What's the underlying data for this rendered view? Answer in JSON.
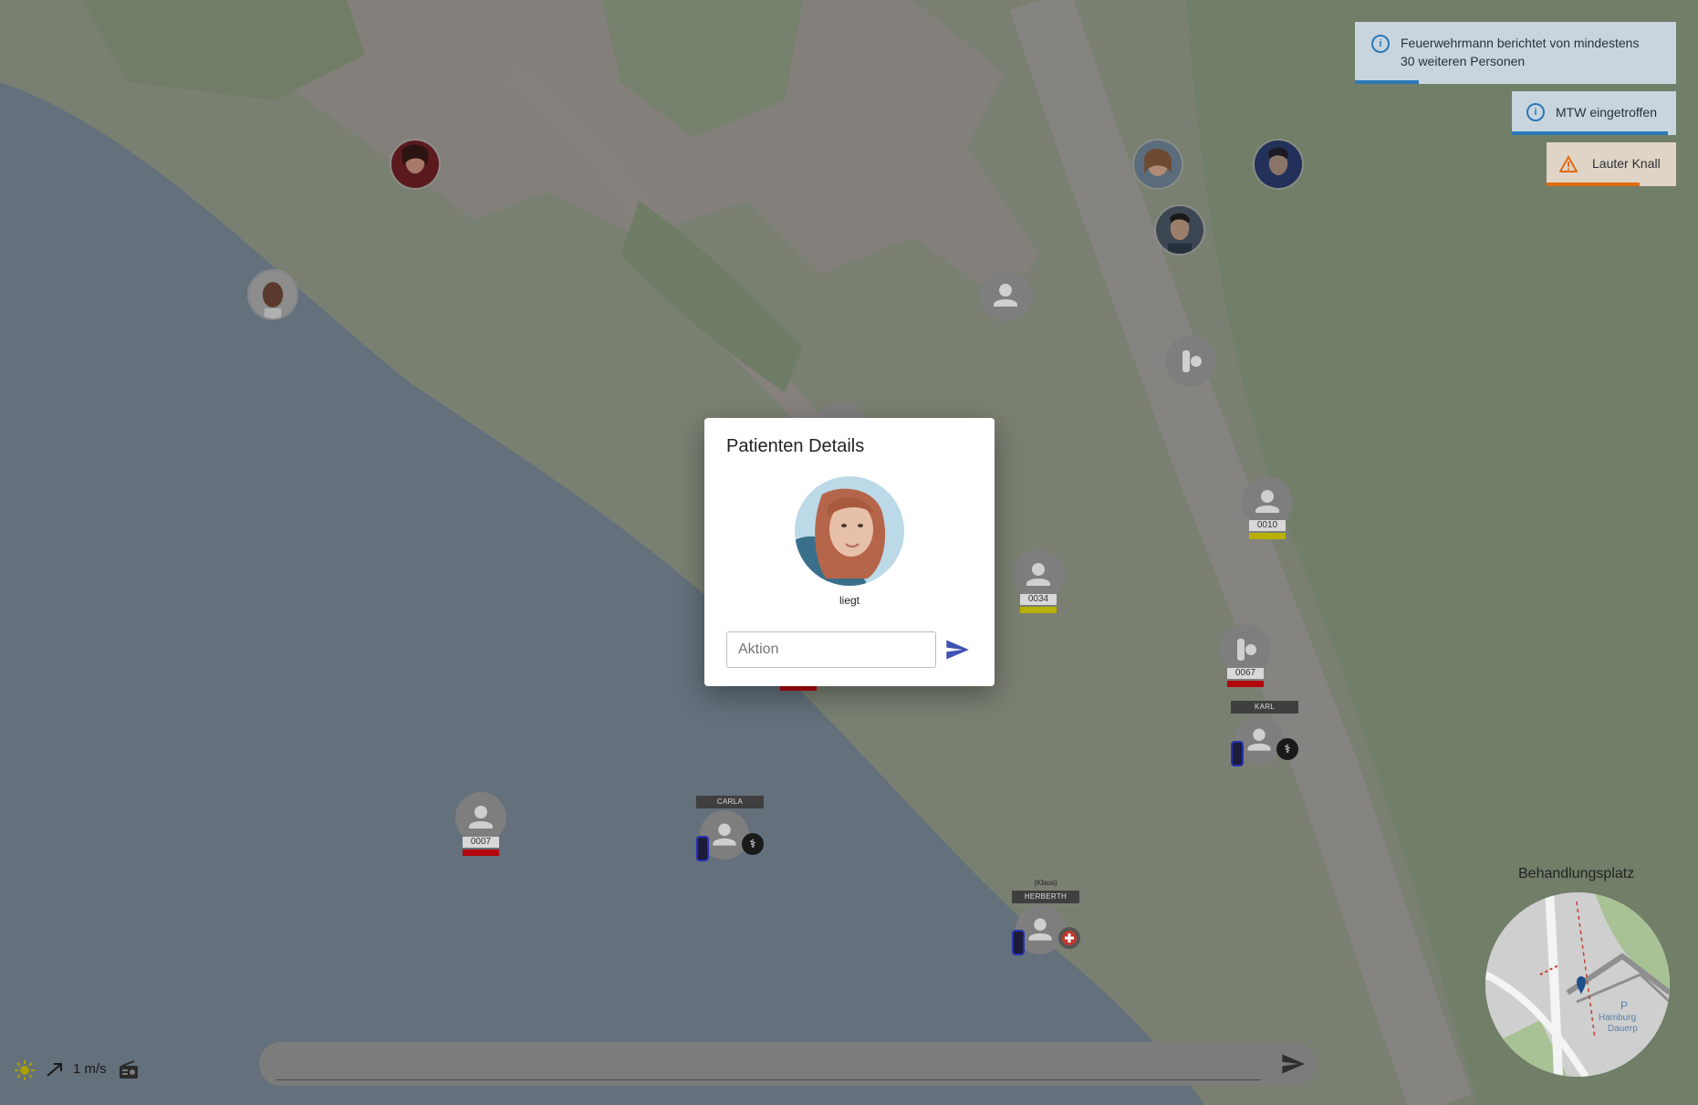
{
  "notifications": [
    {
      "icon": "info-icon",
      "text_line1": "Feuerwehrmann berichtet von mindestens",
      "text_line2": "30 weiteren Personen",
      "progress": 0.2
    },
    {
      "icon": "info-icon",
      "text": "MTW eingetroffen",
      "progress": 0.95
    },
    {
      "icon": "warning-icon",
      "text": "Lauter Knall",
      "progress": 0.72
    }
  ],
  "patients": [
    {
      "id": "0010",
      "triage": "yellow"
    },
    {
      "id": "0034",
      "triage": "yellow"
    },
    {
      "id": "0067",
      "triage": "red"
    },
    {
      "id": "0007",
      "triage": "red"
    }
  ],
  "helpers": [
    {
      "name": "KARL",
      "role": "doctor"
    },
    {
      "name": "CARLA",
      "role": "doctor"
    },
    {
      "name": "HERBERTH",
      "sub": "(Klaus)",
      "role": "paramedic"
    }
  ],
  "dialog": {
    "title": "Patienten Details",
    "status": "liegt",
    "action_placeholder": "Aktion"
  },
  "chat": {
    "placeholder": ""
  },
  "weather": {
    "icon": "sun-icon",
    "wind_icon": "wind-arrow-icon",
    "wind_speed": "1 m/s",
    "radio_icon": "radio-icon"
  },
  "minimap": {
    "title": "Behandlungsplatz",
    "labels": [
      "P",
      "Hamburg",
      "Dauerp"
    ]
  },
  "colors": {
    "triage_red": "#b3070e",
    "triage_yellow": "#b8b000",
    "info_accent": "#2a78b8",
    "warning_accent": "#e06a10",
    "send_icon": "#3f51b5"
  }
}
